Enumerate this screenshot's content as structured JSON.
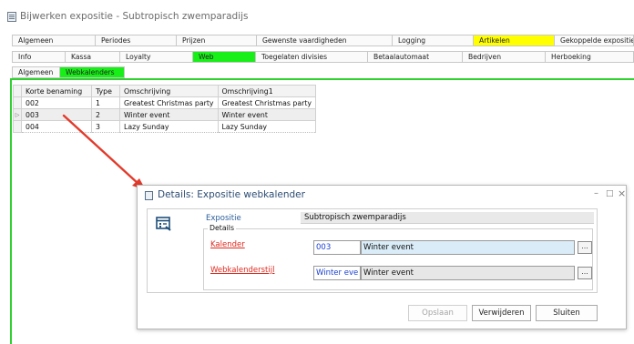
{
  "window": {
    "title": "Bijwerken expositie - Subtropisch zwemparadijs"
  },
  "tabs_row1": [
    {
      "label": "Algemeen",
      "state": "normal"
    },
    {
      "label": "Periodes",
      "state": "normal"
    },
    {
      "label": "Prijzen",
      "state": "normal"
    },
    {
      "label": "Gewenste vaardigheden",
      "state": "normal"
    },
    {
      "label": "Logging",
      "state": "normal"
    },
    {
      "label": "Artikelen",
      "state": "yellow"
    },
    {
      "label": "Gekoppelde exposities",
      "state": "normal"
    }
  ],
  "tabs_row2": [
    {
      "label": "Info",
      "state": "normal"
    },
    {
      "label": "Kassa",
      "state": "normal"
    },
    {
      "label": "Loyalty",
      "state": "normal"
    },
    {
      "label": "Web",
      "state": "green"
    },
    {
      "label": "Toegelaten divisies",
      "state": "normal"
    },
    {
      "label": "Betaalautomaat",
      "state": "normal"
    },
    {
      "label": "Bedrijven",
      "state": "normal"
    },
    {
      "label": "Herboeking",
      "state": "normal"
    }
  ],
  "tabs_row3": [
    {
      "label": "Algemeen",
      "state": "normal"
    },
    {
      "label": "Webkalenders",
      "state": "green"
    }
  ],
  "grid": {
    "columns": [
      "Korte benaming",
      "Type",
      "Omschrijving",
      "Omschrijving1"
    ],
    "rows": [
      [
        "002",
        "1",
        "Greatest Christmas party",
        "Greatest Christmas party"
      ],
      [
        "003",
        "2",
        "Winter event",
        "Winter event"
      ],
      [
        "004",
        "3",
        "Lazy Sunday",
        "Lazy Sunday"
      ]
    ],
    "current_row_indicator": "▷"
  },
  "dialog": {
    "title": "Details: Expositie webkalender",
    "minimize": "–",
    "maximize": "□",
    "close": "×",
    "expositie_label": "Expositie",
    "expositie_value": "Subtropisch zwemparadijs",
    "group_label": "Details",
    "kalender_label": "Kalender",
    "kalender_code": "003",
    "kalender_desc": "Winter event",
    "webkal_label": "Webkalenderstijl",
    "webkal_code": "Winter eve",
    "webkal_desc": "Winter event",
    "lookup_label": "...",
    "save_label": "Opslaan",
    "delete_label": "Verwijderen",
    "close_label": "Sluiten"
  },
  "colors": {
    "tab_active_green": "#18ef18",
    "tab_highlight_yellow": "#ffff00",
    "required_label_red": "#e0281d",
    "arrow_red": "#e23b2c",
    "dialog_title_blue": "#2d4c73"
  }
}
